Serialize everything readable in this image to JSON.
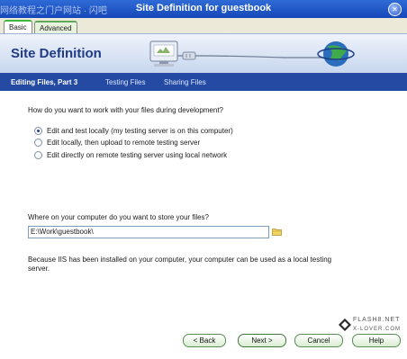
{
  "window": {
    "title": "Site Definition for guestbook",
    "overlay_text": "网络教程之门户网站 · 闪吧",
    "close_glyph": "✕"
  },
  "tabs": [
    {
      "label": "Basic",
      "active": true
    },
    {
      "label": "Advanced",
      "active": false
    }
  ],
  "header": {
    "title": "Site Definition"
  },
  "steps": [
    {
      "label": "Editing Files, Part 3",
      "active": true
    },
    {
      "label": "Testing Files",
      "active": false
    },
    {
      "label": "Sharing Files",
      "active": false
    }
  ],
  "question1": "How do you want to work with your files during development?",
  "options": [
    {
      "label": "Edit and test locally (my testing server is on this computer)",
      "selected": true
    },
    {
      "label": "Edit locally, then upload to remote testing server",
      "selected": false
    },
    {
      "label": "Edit directly on remote testing server using local network",
      "selected": false
    }
  ],
  "question2": "Where on your computer do you want to store your files?",
  "path_value": "E:\\Work\\guestbook\\",
  "info_text": "Because IIS has been installed on your computer, your computer can be used as a local testing server.",
  "brand": {
    "line1": "FLASH8.NET",
    "line2": "X-LOVER.COM"
  },
  "buttons": {
    "back": "< Back",
    "next": "Next >",
    "cancel": "Cancel",
    "help": "Help"
  },
  "colors": {
    "titlebar": "#1f55c6",
    "steps_bar": "#244aa3",
    "header_title": "#203a86",
    "button_border": "#5a8f58"
  }
}
